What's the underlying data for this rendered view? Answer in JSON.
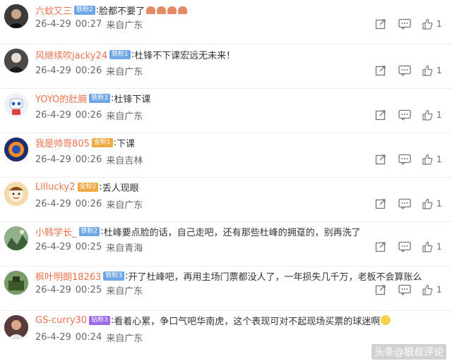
{
  "comments": [
    {
      "user": "六蚊又三",
      "badge": "铁粉2",
      "badge_color": "#6ea6e8",
      "text": "脸都不要了",
      "emoji_count": 4,
      "date": "26-4-29",
      "time": "00:27",
      "location": "来自广东",
      "likes": "1",
      "avatar_bg": "#2b2b2b",
      "avatar_icon": "person-photo-icon"
    },
    {
      "user": "风继续吹jacky24",
      "badge": "铁粉1",
      "badge_color": "#6ea6e8",
      "text": "杜锋不下课宏远无未来！",
      "date": "26-4-29",
      "time": "00:26",
      "location": "来自广东",
      "likes": "1",
      "avatar_bg": "#3a3a3a",
      "avatar_icon": "person-photo-icon"
    },
    {
      "user": "YOYO的肚腩",
      "badge": "铁粉3",
      "badge_color": "#6ea6e8",
      "text": "杜锋下课",
      "date": "26-4-29",
      "time": "00:26",
      "location": "来自广东",
      "likes": "1",
      "avatar_bg": "#dfe6ee",
      "avatar_icon": "robot-avatar-icon"
    },
    {
      "user": "我是帅哥805",
      "badge": "金粉1",
      "badge_color": "#f0a840",
      "text": "下课",
      "date": "26-4-29",
      "time": "00:26",
      "location": "来自吉林",
      "likes": "1",
      "avatar_bg": "#e05020",
      "avatar_icon": "anime-avatar-icon"
    },
    {
      "user": "Llllucky2",
      "badge": "金粉2",
      "badge_color": "#f0a840",
      "text": "丢人现眼",
      "date": "26-4-29",
      "time": "00:26",
      "location": "来自广东",
      "likes": "1",
      "avatar_bg": "#f2c27a",
      "avatar_icon": "cartoon-face-icon"
    },
    {
      "user": "小韩学长_",
      "badge": "铁粉2",
      "badge_color": "#6ea6e8",
      "text": "杜峰要点脸的话，自己走吧，还有那些杜峰的拥趸的，别再洗了",
      "date": "26-4-29",
      "time": "00:25",
      "location": "来自青海",
      "likes": "1",
      "avatar_bg": "#5a7a5a",
      "avatar_icon": "landscape-avatar-icon"
    },
    {
      "user": "枫叶明朗18263",
      "badge": "铁粉3",
      "badge_color": "#6ea6e8",
      "text": "开了杜峰吧，再用主场门票都没人了，一年损失几千万，老板不会算账么",
      "date": "26-4-29",
      "time": "00:25",
      "location": "来自广东",
      "likes": "1",
      "avatar_bg": "#6e8a5a",
      "avatar_icon": "landscape-avatar-icon"
    },
    {
      "user": "GS-curry30",
      "badge": "钻粉3",
      "badge_color": "#9a6ae8",
      "text": "看着心累，争口气吧华南虎，这个表现可对不起现场买票的球迷啊",
      "has_smile": true,
      "date": "26-4-29",
      "time": "00:24",
      "location": "来自广东",
      "likes": "1",
      "avatar_bg": "#553333",
      "avatar_icon": "person-photo-icon"
    }
  ],
  "watermark": "头条@狠叔评论"
}
